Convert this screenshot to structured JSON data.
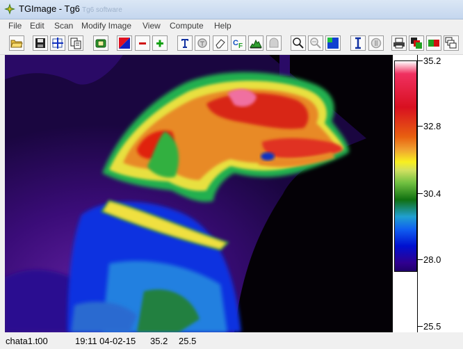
{
  "window": {
    "title": "TGImage - Tg6",
    "ghost_title": "Tg6 software"
  },
  "menu": [
    "File",
    "Edit",
    "Scan",
    "Modify Image",
    "View",
    "Compute",
    "Help"
  ],
  "toolbar": [
    {
      "icon": "open-folder-icon"
    },
    {
      "icon": "save-icon"
    },
    {
      "icon": "crosshair-icon"
    },
    {
      "icon": "copy-icon"
    },
    {
      "icon": "camera-icon"
    },
    {
      "icon": "color-palette-icon"
    },
    {
      "icon": "minus-icon"
    },
    {
      "icon": "plus-icon"
    },
    {
      "icon": "text-tool-icon"
    },
    {
      "icon": "disabled-circle-icon"
    },
    {
      "icon": "eraser-icon"
    },
    {
      "icon": "celsius-fahrenheit-icon"
    },
    {
      "icon": "histogram-icon"
    },
    {
      "icon": "disabled-profile-icon"
    },
    {
      "icon": "zoom-in-icon"
    },
    {
      "icon": "zoom-disabled-icon"
    },
    {
      "icon": "region-icon"
    },
    {
      "icon": "cursor-beam-icon"
    },
    {
      "icon": "disabled-stop-icon"
    },
    {
      "icon": "print-icon"
    },
    {
      "icon": "layers-icon"
    },
    {
      "icon": "compare-icon"
    },
    {
      "icon": "cascade-icon"
    }
  ],
  "temperature_scale": {
    "labels": [
      "35.2",
      "32.8",
      "30.4",
      "28.0",
      "25.5"
    ],
    "max": 35.2,
    "min": 25.5
  },
  "status": {
    "filename": "chata1.t00",
    "time_date": "19:11 04-02-15",
    "max_temp": "35.2",
    "min_temp": "25.5"
  }
}
